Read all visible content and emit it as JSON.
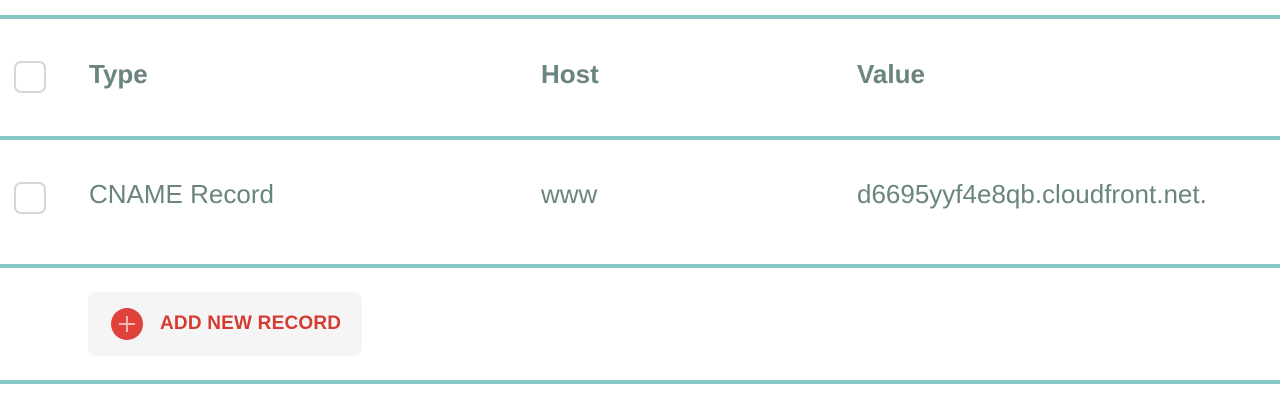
{
  "table": {
    "columns": {
      "type": "Type",
      "host": "Host",
      "value": "Value"
    },
    "rows": [
      {
        "type": "CNAME Record",
        "host": "www",
        "value": "d6695yyf4e8qb.cloudfront.net."
      }
    ]
  },
  "actions": {
    "add_record_label": "ADD NEW RECORD",
    "add_record_icon": "plus-circle-icon"
  },
  "colors": {
    "divider": "#88c6c4",
    "text": "#6a8480",
    "accent": "#e0413a",
    "button_bg": "#f5f5f5"
  }
}
